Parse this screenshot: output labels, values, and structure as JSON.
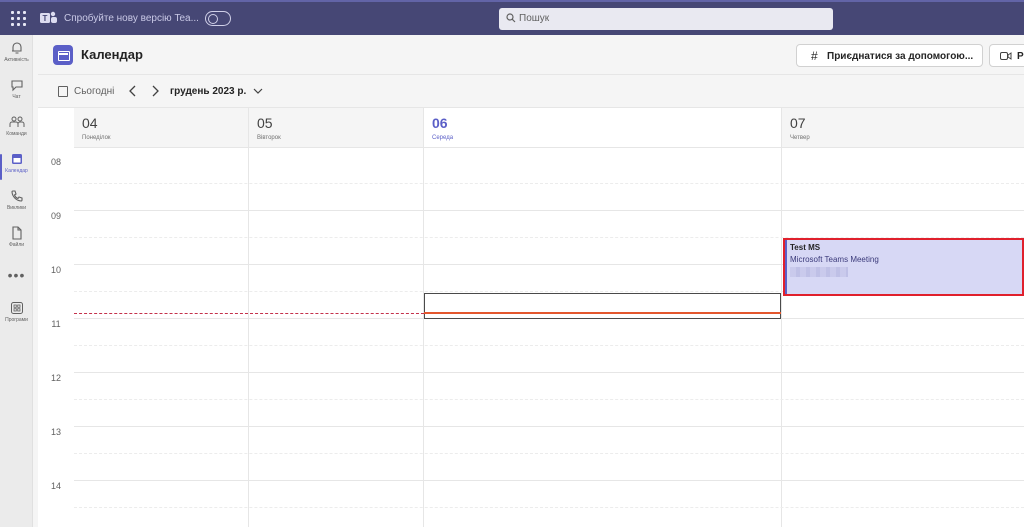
{
  "topbar": {
    "try_new_text": "Спробуйте нову версію Tea...",
    "search_placeholder": "Пошук"
  },
  "rail": {
    "items": [
      {
        "label": "Активність",
        "icon": "bell-icon"
      },
      {
        "label": "Чат",
        "icon": "chat-icon"
      },
      {
        "label": "Команди",
        "icon": "teams-icon"
      },
      {
        "label": "Календар",
        "icon": "calendar-icon",
        "active": true
      },
      {
        "label": "Виклики",
        "icon": "phone-icon"
      },
      {
        "label": "Файли",
        "icon": "file-icon"
      },
      {
        "label": "Програми",
        "icon": "apps-icon"
      }
    ],
    "more_label": "•••"
  },
  "header": {
    "title": "Календар",
    "join_button": "Приєднатися за допомогою...",
    "meet_button": "Р"
  },
  "toolbar": {
    "today_label": "Сьогодні",
    "month_label": "грудень 2023 р."
  },
  "calendar": {
    "days": [
      {
        "num": "04",
        "name": "Понеділок"
      },
      {
        "num": "05",
        "name": "Вівторок"
      },
      {
        "num": "06",
        "name": "Середа",
        "today": true
      },
      {
        "num": "07",
        "name": "Четвер"
      }
    ],
    "hours": [
      "08",
      "09",
      "10",
      "11",
      "12",
      "13",
      "14"
    ],
    "event": {
      "title": "Test MS",
      "subtitle": "Microsoft Teams Meeting"
    }
  },
  "colors": {
    "topbar": "#464775",
    "accent": "#5b5fc7",
    "event_bg": "#d7d8f5",
    "event_highlight": "#e0202c",
    "now_line": "#e4572e"
  }
}
